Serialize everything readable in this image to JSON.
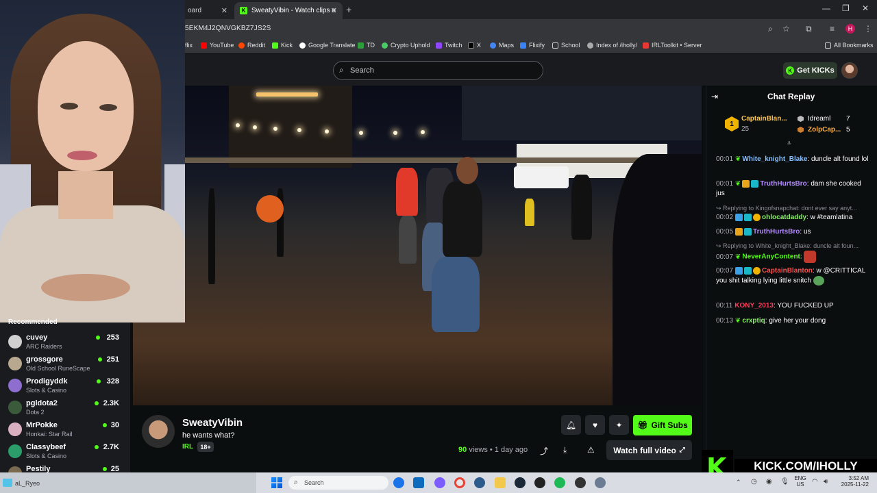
{
  "browser": {
    "tabs": [
      {
        "label": "oard",
        "active": false
      },
      {
        "label": "SweatyVibin - Watch clips o",
        "active": true
      }
    ],
    "url": "5EKM4J2QNVGKBZ7JS2S",
    "bookmarks": [
      "flix",
      "YouTube",
      "Reddit",
      "Kick",
      "Google Translate",
      "TD",
      "Crypto Uphold",
      "Twitch",
      "X",
      "Maps",
      "Flixify",
      "School",
      "Index of /iholly/",
      "IRLToolkit • Server"
    ],
    "all_bookmarks": "All Bookmarks",
    "profile_initial": "H"
  },
  "header": {
    "search_placeholder": "Search",
    "get_kicks": "Get KICKs"
  },
  "sidebar": {
    "title": "Recommended",
    "items": [
      {
        "name": "cuvey",
        "category": "ARC Raiders",
        "viewers": "253",
        "color": "#d0d0d0"
      },
      {
        "name": "grossgore",
        "category": "Old School RuneScape",
        "viewers": "251",
        "color": "#b8a890"
      },
      {
        "name": "Prodigyddk",
        "category": "Slots & Casino",
        "viewers": "328",
        "color": "#8e6fd0"
      },
      {
        "name": "pgldota2",
        "category": "Dota 2",
        "viewers": "2.3K",
        "color": "#3b5a3b"
      },
      {
        "name": "MrPokke",
        "category": "Honkai: Star Rail",
        "viewers": "30",
        "color": "#d8b0c0"
      },
      {
        "name": "Classybeef",
        "category": "Slots & Casino",
        "viewers": "2.7K",
        "color": "#2a9d6a"
      },
      {
        "name": "Pestily",
        "category": "",
        "viewers": "25",
        "color": "#7a6a50"
      }
    ]
  },
  "video": {
    "channel": "SweatyVibin",
    "title": "he wants what?",
    "category": "IRL",
    "badge": "18+",
    "gift_subs": "Gift Subs",
    "views_count": "90",
    "views_label": "views",
    "age": "• 1 day ago",
    "watch_full": "Watch full video"
  },
  "chat": {
    "title": "Chat Replay",
    "leaderboard": {
      "first": {
        "name": "CaptainBlan...",
        "score": "25"
      },
      "second": {
        "name": "Idreaml",
        "score": "7"
      },
      "third": {
        "name": "ZolpCap...",
        "score": "5"
      }
    },
    "messages": [
      {
        "time": "00:01",
        "user": "White_knight_Blake",
        "color": "#88c0ff",
        "text": "duncle alt found lol",
        "reply": ""
      },
      {
        "time": "00:01",
        "user": "TruthHurtsBro",
        "color": "#b48cff",
        "text": "dam she cooked jus",
        "reply": ""
      },
      {
        "time": "00:02",
        "user": "ohlocatdaddy",
        "color": "#8cf06a",
        "text": "w #teamlatina",
        "reply": "Replying to Kingofsnapchat: dont ever say anyt..."
      },
      {
        "time": "00:05",
        "user": "TruthHurtsBro",
        "color": "#b48cff",
        "text": "us",
        "reply": ""
      },
      {
        "time": "00:07",
        "user": "NeverAnyContent",
        "color": "#53fc18",
        "text": "",
        "reply": "Replying to White_knight_Blake: duncle alt foun..."
      },
      {
        "time": "00:07",
        "user": "CaptainBlanton",
        "color": "#ff4d4d",
        "text": "w @CRITTICAL you shit talking lying little snitch",
        "reply": ""
      },
      {
        "time": "00:11",
        "user": "KONY_2013",
        "color": "#ff3b5c",
        "text": "YOU FUCKED UP",
        "reply": ""
      },
      {
        "time": "00:13",
        "user": "crxptiq",
        "color": "#8cf06a",
        "text": "give her your dong",
        "reply": ""
      }
    ]
  },
  "watermark": "KICK.COM/IHOLLY",
  "taskbar": {
    "left_label": "aL_Ryeo",
    "search": "Search",
    "lang": "ENG\nUS",
    "time": "3:52 AM",
    "date": "2025-11-22"
  }
}
